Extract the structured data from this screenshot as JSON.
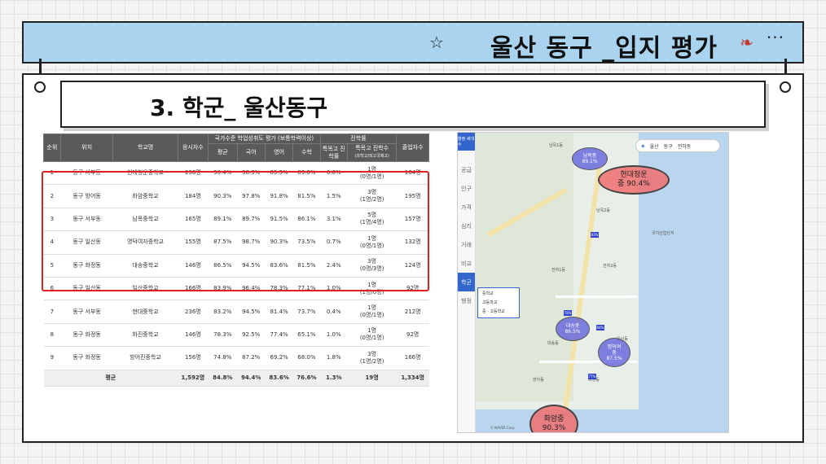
{
  "banner": {
    "title": "울산 동구 _입지 평가",
    "more": "···"
  },
  "section": {
    "title": "3.  학군_ 울산동구"
  },
  "table": {
    "headers": {
      "rank": "순위",
      "location": "위치",
      "school": "학교명",
      "students": "응시자수",
      "national_group": "국가수준 학업성취도 평가 (보통학력이상)",
      "avg": "평균",
      "kor": "국어",
      "eng": "영어",
      "math": "수학",
      "advance_group": "진학률",
      "special_rate": "특목고 진학률",
      "special_count": "특목고 진학수",
      "special_count_sub": "(과학고/외고국제고)",
      "grads": "졸업자수"
    },
    "rows": [
      [
        "1",
        "동구 서부동",
        "현대청운중학교",
        "238명",
        "90.4%",
        "98.3%",
        "89.5%",
        "83.6%",
        "0.6%",
        "1명",
        "(0명/1명)",
        "164명"
      ],
      [
        "2",
        "동구 방어동",
        "화암중학교",
        "184명",
        "90.3%",
        "97.8%",
        "91.8%",
        "81.5%",
        "1.5%",
        "3명",
        "(1명/2명)",
        "195명"
      ],
      [
        "3",
        "동구 서부동",
        "남목중학교",
        "165명",
        "89.1%",
        "89.7%",
        "91.5%",
        "86.1%",
        "3.1%",
        "5명",
        "(1명/4명)",
        "157명"
      ],
      [
        "4",
        "동구 일산동",
        "명덕여자중학교",
        "155명",
        "87.5%",
        "98.7%",
        "90.3%",
        "73.5%",
        "0.7%",
        "1명",
        "(0명/1명)",
        "132명"
      ],
      [
        "5",
        "동구 화정동",
        "대송중학교",
        "146명",
        "86.5%",
        "94.5%",
        "83.6%",
        "81.5%",
        "2.4%",
        "3명",
        "(0명/3명)",
        "124명"
      ],
      [
        "6",
        "동구 일산동",
        "일산중학교",
        "166명",
        "83.9%",
        "96.4%",
        "78.3%",
        "77.1%",
        "1.0%",
        "1명",
        "(1명/0명)",
        "92명"
      ],
      [
        "7",
        "동구 서부동",
        "현대중학교",
        "236명",
        "83.2%",
        "94.5%",
        "81.4%",
        "73.7%",
        "0.4%",
        "1명",
        "(0명/1명)",
        "212명"
      ],
      [
        "8",
        "동구 화정동",
        "화진중학교",
        "146명",
        "78.3%",
        "92.5%",
        "77.4%",
        "65.1%",
        "1.0%",
        "1명",
        "(0명/1명)",
        "92명"
      ],
      [
        "9",
        "동구 화정동",
        "방어진중학교",
        "156명",
        "74.8%",
        "87.2%",
        "69.2%",
        "68.0%",
        "1.8%",
        "3명",
        "(1명/2명)",
        "166명"
      ]
    ],
    "average": {
      "label": "평균",
      "students": "1,592명",
      "avg": "84.8%",
      "kor": "94.4%",
      "eng": "83.6%",
      "math": "76.6%",
      "rate": "1.3%",
      "count": "19명",
      "grads": "1,334명"
    }
  },
  "map": {
    "search": {
      "region1": "울산",
      "region2": "동구",
      "region3": "전하동"
    },
    "side_tabs": [
      "행정 세대수",
      "공급",
      "인구",
      "가격",
      "심리",
      "거래",
      "비교",
      "학군",
      "행정"
    ],
    "legend": [
      "중학교",
      "고등학교",
      "중 · 고등학교"
    ],
    "blobs": {
      "nammok": "남목중\n89.1%",
      "hyundai_cheongun": "현대청운\n중 90.4%",
      "daesong": "대송중\n86.5%",
      "myeongdeok": "명덕여\n중\n87.5%",
      "hwaam": "화암중\n90.3%"
    },
    "labels": [
      "남목1동",
      "남목2동",
      "전하2동",
      "전하1동",
      "일산동",
      "방어동",
      "화정동",
      "대송동",
      "국가산업단지"
    ],
    "marks": [
      "83%",
      "84%",
      "78%",
      "77%"
    ],
    "copyright": "© NAVER Corp."
  }
}
